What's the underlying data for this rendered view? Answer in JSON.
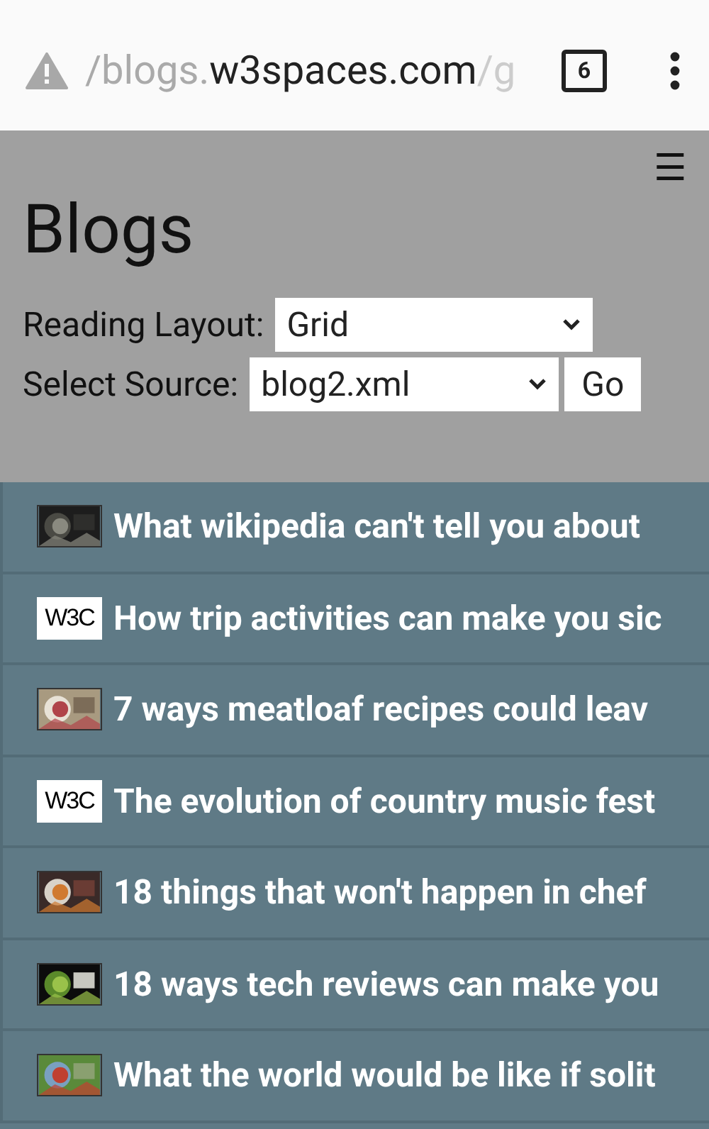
{
  "browser": {
    "url_faded_start": "/blogs.",
    "url_host": "w3spaces.com",
    "url_faded_end": "/g",
    "tab_count": "6"
  },
  "page": {
    "menu_glyph": "☰",
    "title": "Blogs",
    "layout_label": "Reading Layout:",
    "layout_value": "Grid",
    "source_label": "Select Source:",
    "source_value": "blog2.xml",
    "go_button": "Go"
  },
  "posts": [
    {
      "kind": "picture",
      "title": "What wikipedia can't tell you about"
    },
    {
      "kind": "logo",
      "logo_text": "W3C",
      "title": "How trip activities can make you sic"
    },
    {
      "kind": "picture",
      "title": "7 ways meatloaf recipes could leav"
    },
    {
      "kind": "logo",
      "logo_text": "W3C",
      "title": "The evolution of country music fest"
    },
    {
      "kind": "picture",
      "title": "18 things that won't happen in chef"
    },
    {
      "kind": "picture",
      "title": "18 ways tech reviews can make you"
    },
    {
      "kind": "picture",
      "title": "What the world would be like if solit"
    }
  ]
}
